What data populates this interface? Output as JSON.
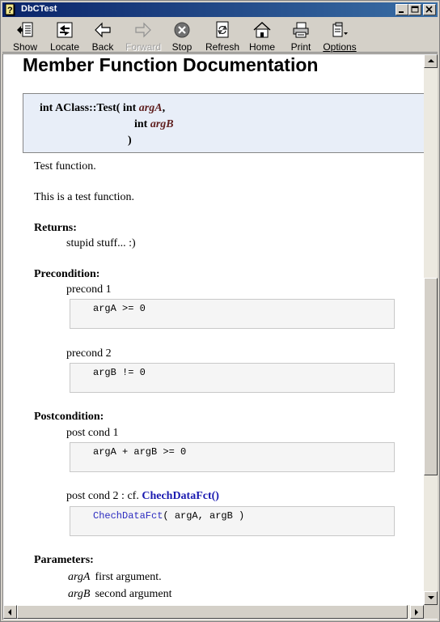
{
  "window": {
    "title": "DbCTest"
  },
  "toolbar": {
    "items": [
      {
        "label": "Show",
        "icon": "show-icon",
        "enabled": true
      },
      {
        "label": "Locate",
        "icon": "locate-icon",
        "enabled": true
      },
      {
        "label": "Back",
        "icon": "back-arrow-icon",
        "enabled": true
      },
      {
        "label": "Forward",
        "icon": "forward-arrow-icon",
        "enabled": false
      },
      {
        "label": "Stop",
        "icon": "stop-icon",
        "enabled": true
      },
      {
        "label": "Refresh",
        "icon": "refresh-icon",
        "enabled": true
      },
      {
        "label": "Home",
        "icon": "home-icon",
        "enabled": true
      },
      {
        "label": "Print",
        "icon": "printer-icon",
        "enabled": true
      },
      {
        "label": "Options",
        "icon": "options-icon",
        "enabled": true
      }
    ]
  },
  "doc": {
    "heading": "Member Function Documentation",
    "prototype": {
      "prefix": "int AClass::Test( int ",
      "param1": "argA",
      "comma": ",",
      "line2_type": "int ",
      "param2": "argB",
      "close": ")"
    },
    "brief": "Test function.",
    "detail": "This is a test function.",
    "returns": {
      "title": "Returns:",
      "text": "stupid stuff... :)"
    },
    "precondition": {
      "title": "Precondition:",
      "items": [
        {
          "label": "precond 1",
          "code": "argA >= 0"
        },
        {
          "label": "precond 2",
          "code": "argB != 0"
        }
      ]
    },
    "postcondition": {
      "title": "Postcondition:",
      "items": [
        {
          "label": "post cond 1",
          "code": "argA + argB >= 0"
        },
        {
          "label": "post cond 2 : cf. ",
          "link": "ChechDataFct()",
          "code_fn": "ChechDataFct",
          "code_rest": "( argA, argB )"
        }
      ]
    },
    "parameters": {
      "title": "Parameters:",
      "items": [
        {
          "name": "argA",
          "desc": "first argument."
        },
        {
          "name": "argB",
          "desc": "second argument"
        }
      ]
    }
  }
}
